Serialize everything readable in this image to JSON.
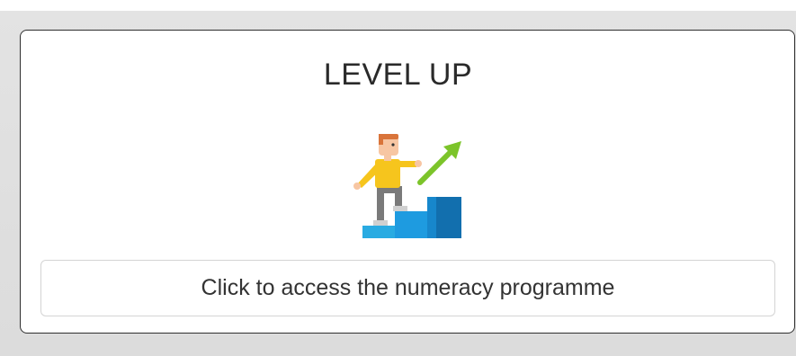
{
  "card": {
    "title": "LEVEL UP",
    "illustration_icon": "person-climbing-steps-growth-arrow-icon",
    "button_label": "Click to access the numeracy programme"
  },
  "colors": {
    "background": "#dcdcdc",
    "card_border": "#2f2f2f",
    "step_blue": "#1e9be0",
    "arrow_green": "#7cc42a",
    "shirt_yellow": "#f6c51d"
  }
}
